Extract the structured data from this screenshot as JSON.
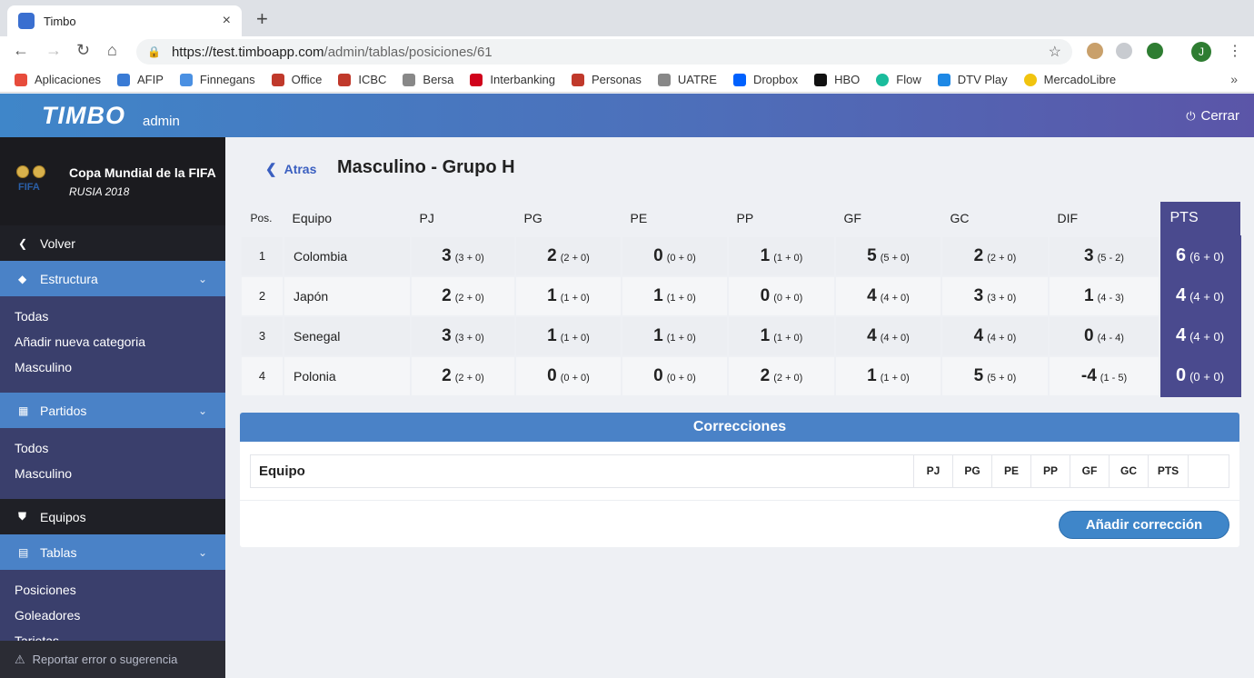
{
  "browser": {
    "tab_title": "Timbo",
    "tab_close": "×",
    "new_tab": "+",
    "url_host": "https://test.timboapp.com",
    "url_path": "/admin/tablas/posiciones/61",
    "profile_initial": "J",
    "bookmarks": [
      {
        "label": "Aplicaciones",
        "color": "#e74c3c"
      },
      {
        "label": "AFIP",
        "color": "#3a7bd5"
      },
      {
        "label": "Finnegans",
        "color": "#4a90e2"
      },
      {
        "label": "Office",
        "color": "#c0392b"
      },
      {
        "label": "ICBC",
        "color": "#c0392b"
      },
      {
        "label": "Bersa",
        "color": "#888888"
      },
      {
        "label": "Interbanking",
        "color": "#d0021b"
      },
      {
        "label": "Personas",
        "color": "#c0392b"
      },
      {
        "label": "UATRE",
        "color": "#888888"
      },
      {
        "label": "Dropbox",
        "color": "#0061fe"
      },
      {
        "label": "HBO",
        "color": "#111111"
      },
      {
        "label": "Flow",
        "color": "#1abc9c"
      },
      {
        "label": "DTV Play",
        "color": "#1e88e5"
      },
      {
        "label": "MercadoLibre",
        "color": "#f1c40f"
      }
    ],
    "bookmarks_more": "»"
  },
  "header": {
    "logo": "TIMBO",
    "logo_sub": "admin",
    "logout_label": "Cerrar"
  },
  "sidebar": {
    "tournament_name": "Copa Mundial de la FIFA",
    "tournament_sub": "RUSIA 2018",
    "fifa_mark": "FIFA",
    "volver": "Volver",
    "estructura": "Estructura",
    "estructura_links": [
      "Todas",
      "Añadir nueva categoria",
      "Masculino"
    ],
    "partidos": "Partidos",
    "partidos_links": [
      "Todos",
      "Masculino"
    ],
    "equipos": "Equipos",
    "tablas": "Tablas",
    "tablas_links": [
      "Posiciones",
      "Goleadores",
      "Tarjetas"
    ],
    "report": "Reportar error o sugerencia"
  },
  "main": {
    "back_label": "Atras",
    "title": "Masculino - Grupo H",
    "columns": [
      "Pos.",
      "Equipo",
      "PJ",
      "PG",
      "PE",
      "PP",
      "GF",
      "GC",
      "DIF",
      "PTS"
    ],
    "rows": [
      {
        "pos": "1",
        "team": "Colombia",
        "pj": [
          "3",
          "(3 + 0)"
        ],
        "pg": [
          "2",
          "(2 + 0)"
        ],
        "pe": [
          "0",
          "(0 + 0)"
        ],
        "pp": [
          "1",
          "(1 + 0)"
        ],
        "gf": [
          "5",
          "(5 + 0)"
        ],
        "gc": [
          "2",
          "(2 + 0)"
        ],
        "dif": [
          "3",
          "(5 - 2)"
        ],
        "pts": [
          "6",
          "(6 + 0)"
        ]
      },
      {
        "pos": "2",
        "team": "Japón",
        "pj": [
          "2",
          "(2 + 0)"
        ],
        "pg": [
          "1",
          "(1 + 0)"
        ],
        "pe": [
          "1",
          "(1 + 0)"
        ],
        "pp": [
          "0",
          "(0 + 0)"
        ],
        "gf": [
          "4",
          "(4 + 0)"
        ],
        "gc": [
          "3",
          "(3 + 0)"
        ],
        "dif": [
          "1",
          "(4 - 3)"
        ],
        "pts": [
          "4",
          "(4 + 0)"
        ]
      },
      {
        "pos": "3",
        "team": "Senegal",
        "pj": [
          "3",
          "(3 + 0)"
        ],
        "pg": [
          "1",
          "(1 + 0)"
        ],
        "pe": [
          "1",
          "(1 + 0)"
        ],
        "pp": [
          "1",
          "(1 + 0)"
        ],
        "gf": [
          "4",
          "(4 + 0)"
        ],
        "gc": [
          "4",
          "(4 + 0)"
        ],
        "dif": [
          "0",
          "(4 - 4)"
        ],
        "pts": [
          "4",
          "(4 + 0)"
        ]
      },
      {
        "pos": "4",
        "team": "Polonia",
        "pj": [
          "2",
          "(2 + 0)"
        ],
        "pg": [
          "0",
          "(0 + 0)"
        ],
        "pe": [
          "0",
          "(0 + 0)"
        ],
        "pp": [
          "2",
          "(2 + 0)"
        ],
        "gf": [
          "1",
          "(1 + 0)"
        ],
        "gc": [
          "5",
          "(5 + 0)"
        ],
        "dif": [
          "-4",
          "(1 - 5)"
        ],
        "pts": [
          "0",
          "(0 + 0)"
        ]
      }
    ],
    "corrections": {
      "title": "Correcciones",
      "columns": [
        "Equipo",
        "PJ",
        "PG",
        "PE",
        "PP",
        "GF",
        "GC",
        "PTS"
      ],
      "add_button": "Añadir corrección"
    }
  },
  "colors": {
    "accent_blue": "#4a82c7",
    "pts_purple": "#4a4a8e",
    "sidebar_bg": "#3a3f6c"
  }
}
